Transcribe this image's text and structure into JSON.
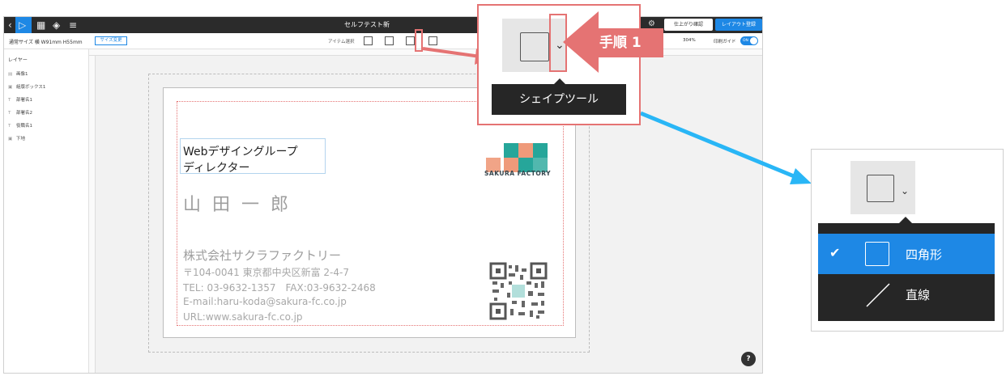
{
  "colors": {
    "accent": "#1e88e5",
    "callout": "#e57373",
    "arrow_blue": "#29b6f6",
    "topbar": "#2b2b2b",
    "dark_menu": "#262626"
  },
  "topbar": {
    "title": "セルフテスト新",
    "confirm_label": "仕上がり確認",
    "register_label": "レイアウト登録",
    "icons": [
      "back-icon",
      "pointer-icon",
      "grid-icon",
      "layers-icon",
      "align-icon",
      "gear-icon"
    ]
  },
  "toolbar": {
    "size_text": "通常サイズ 横 W91mm H55mm",
    "size_change_label": "サイズ変更",
    "item_select_label": "アイテム選択",
    "zoom": "304%",
    "print_guide_label": "印刷ガイド",
    "toggle_label": "ON"
  },
  "layers": {
    "title": "レイヤー",
    "items": [
      {
        "label": "画像1",
        "icon": "image-icon"
      },
      {
        "label": "組版ボックス1",
        "icon": "textbox-icon"
      },
      {
        "label": "部署名1",
        "icon": "text-icon"
      },
      {
        "label": "部署名2",
        "icon": "text-icon"
      },
      {
        "label": "役職名1",
        "icon": "text-icon"
      },
      {
        "label": "下地",
        "icon": "background-icon"
      }
    ]
  },
  "card": {
    "dept_line1": "Webデザイングループ",
    "dept_line2": "ディレクター",
    "name": "山田一郎",
    "company": "株式会社サクラファクトリー",
    "address": "〒104-0041 東京都中央区新富 2-4-7",
    "tel": "TEL: 03-9632-1357　FAX:03-9632-2468",
    "email": "E-mail:haru-koda@sakura-fc.co.jp",
    "url": "URL:www.sakura-fc.co.jp",
    "logo_text": "SAKURA FACTORY"
  },
  "callout": {
    "step_label": "手順 1",
    "tooltip": "シェイプツール"
  },
  "dropdown": {
    "items": [
      {
        "label": "四角形",
        "selected": true,
        "icon": "rectangle-icon"
      },
      {
        "label": "直線",
        "selected": false,
        "icon": "line-icon"
      }
    ]
  },
  "help_label": "?"
}
